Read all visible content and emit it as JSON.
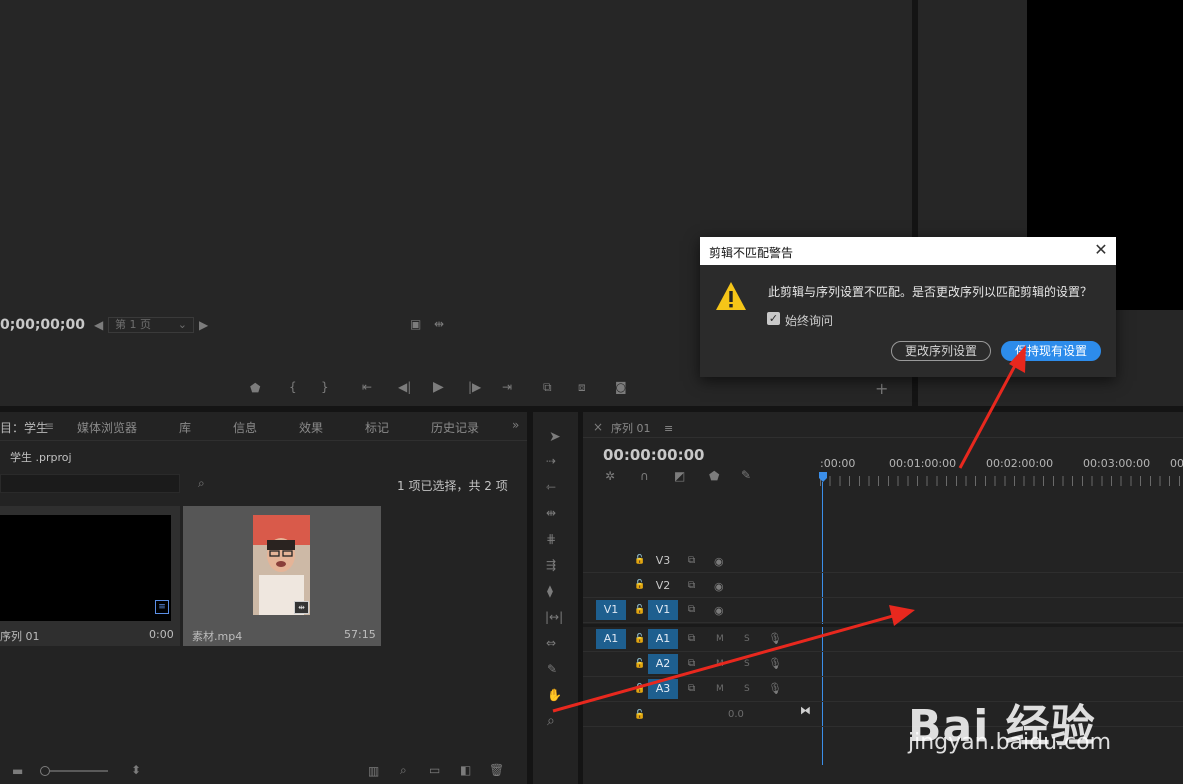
{
  "source_monitor": {
    "timecode": "0;00;00;00",
    "page_select": "第 1 页"
  },
  "project_panel": {
    "tabs": [
      {
        "label": "目：学生"
      },
      {
        "label": "媒体浏览器"
      },
      {
        "label": "库"
      },
      {
        "label": "信息"
      },
      {
        "label": "效果"
      },
      {
        "label": "标记"
      },
      {
        "label": "历史记录"
      }
    ],
    "project_name": "学生 .prproj",
    "selection_status": "1 项已选择，共 2 项",
    "items": [
      {
        "name": "序列 01",
        "duration": "0:00"
      },
      {
        "name": "素材.mp4",
        "duration": "57:15"
      }
    ]
  },
  "timeline": {
    "tab_label": "序列 01",
    "timecode": "00:00:00:00",
    "ruler_labels": [
      ":00:00",
      "00:01:00:00",
      "00:02:00:00",
      "00:03:00:00",
      "00"
    ],
    "video_tracks": [
      {
        "source": "",
        "label": "V3",
        "targeted": false
      },
      {
        "source": "",
        "label": "V2",
        "targeted": false
      },
      {
        "source": "V1",
        "label": "V1",
        "targeted": true
      }
    ],
    "audio_tracks": [
      {
        "source": "A1",
        "label": "A1",
        "targeted": true,
        "m": "M",
        "s": "S"
      },
      {
        "source": "",
        "label": "A2",
        "targeted": true,
        "m": "M",
        "s": "S"
      },
      {
        "source": "",
        "label": "A3",
        "targeted": true,
        "m": "M",
        "s": "S"
      }
    ],
    "master_volume": "0.0"
  },
  "dialog": {
    "title": "剪辑不匹配警告",
    "message": "此剪辑与序列设置不匹配。是否更改序列以匹配剪辑的设置？",
    "always_ask_label": "始终询问",
    "always_ask_checked": true,
    "change_button": "更改序列设置",
    "keep_button": "保持现有设置"
  },
  "watermark": {
    "logo": "Bai 经验",
    "url": "jingyan.baidu.com"
  },
  "colors": {
    "accent_blue": "#2d8ceb",
    "track_blue": "#1e5f8f",
    "annotation_red": "#e8281e",
    "playhead": "#3b8ee8"
  }
}
